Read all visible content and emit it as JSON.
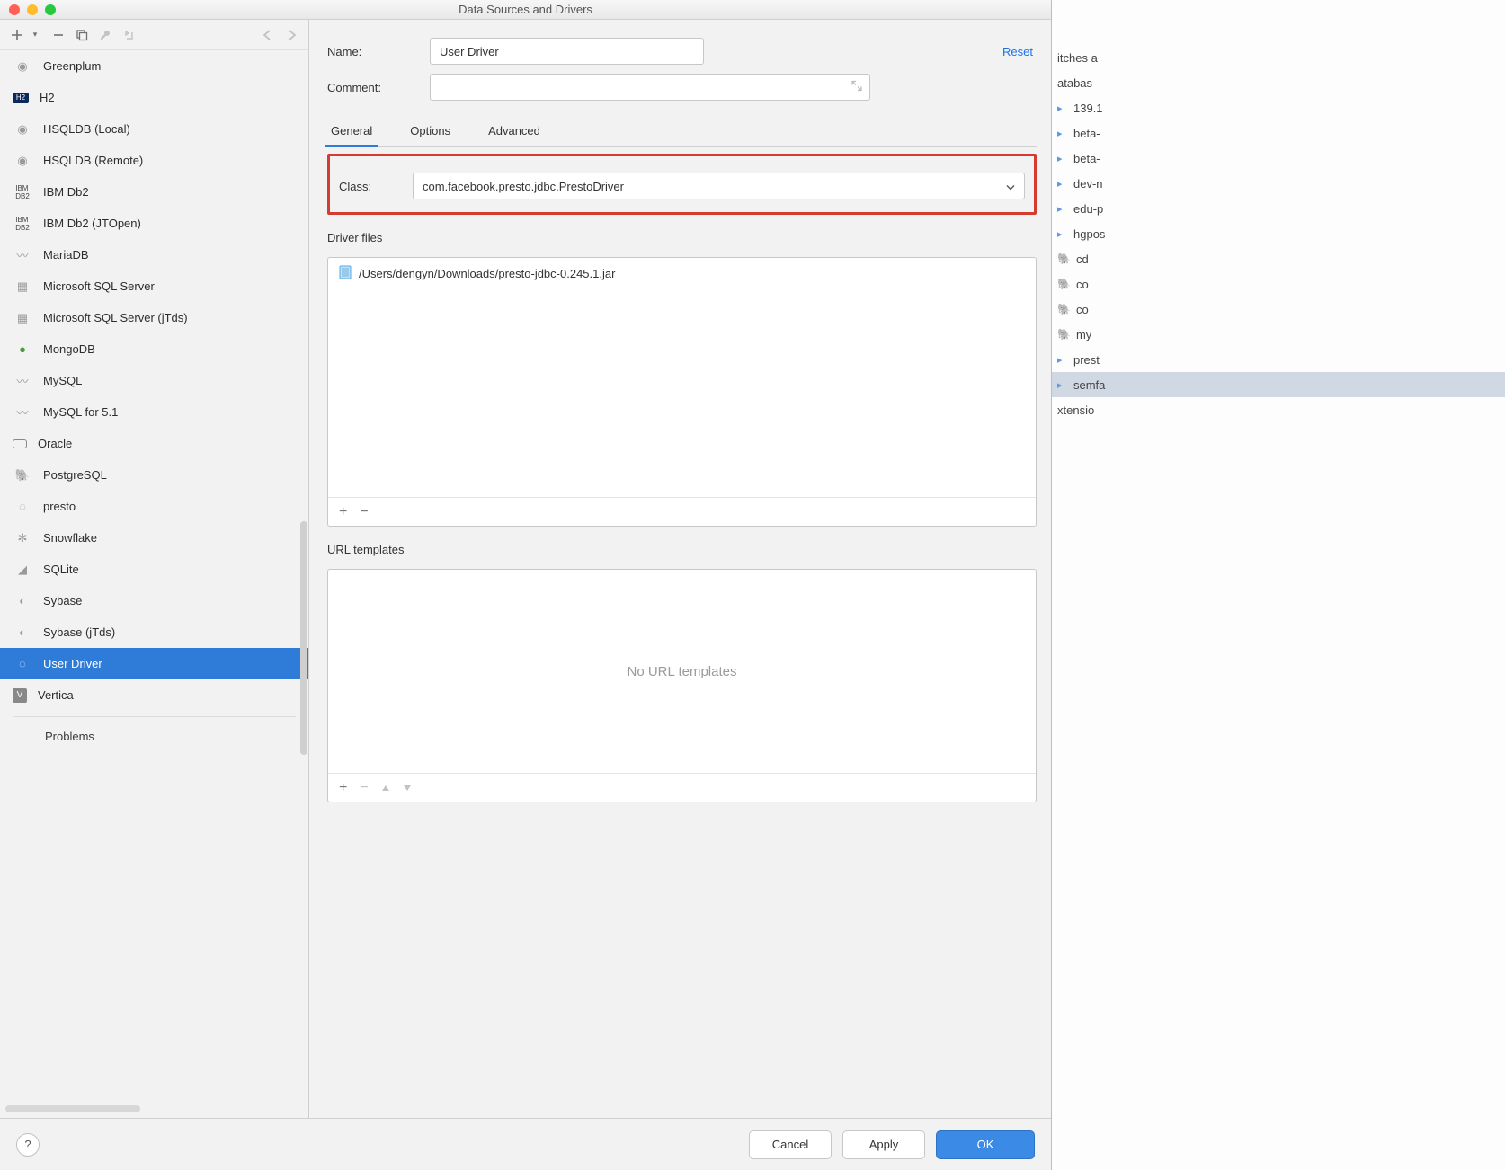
{
  "titlebar": {
    "title": "Data Sources and Drivers"
  },
  "sidebar": {
    "items": [
      {
        "label": "Greenplum"
      },
      {
        "label": "H2"
      },
      {
        "label": "HSQLDB (Local)"
      },
      {
        "label": "HSQLDB (Remote)"
      },
      {
        "label": "IBM Db2"
      },
      {
        "label": "IBM Db2 (JTOpen)"
      },
      {
        "label": "MariaDB"
      },
      {
        "label": "Microsoft SQL Server"
      },
      {
        "label": "Microsoft SQL Server (jTds)"
      },
      {
        "label": "MongoDB"
      },
      {
        "label": "MySQL"
      },
      {
        "label": "MySQL for 5.1"
      },
      {
        "label": "Oracle"
      },
      {
        "label": "PostgreSQL"
      },
      {
        "label": "presto"
      },
      {
        "label": "Snowflake"
      },
      {
        "label": "SQLite"
      },
      {
        "label": "Sybase"
      },
      {
        "label": "Sybase (jTds)"
      },
      {
        "label": "User Driver",
        "selected": true
      },
      {
        "label": "Vertica"
      }
    ],
    "problems_label": "Problems"
  },
  "form": {
    "name_label": "Name:",
    "name_value": "User Driver",
    "comment_label": "Comment:",
    "reset_label": "Reset",
    "tabs": {
      "general": "General",
      "options": "Options",
      "advanced": "Advanced"
    },
    "class_label": "Class:",
    "class_value": "com.facebook.presto.jdbc.PrestoDriver",
    "driver_files_label": "Driver files",
    "driver_file_path": "/Users/dengyn/Downloads/presto-jdbc-0.245.1.jar",
    "url_templates_label": "URL templates",
    "url_templates_empty": "No URL templates"
  },
  "buttons": {
    "cancel": "Cancel",
    "apply": "Apply",
    "ok": "OK",
    "help": "?"
  },
  "background": {
    "rows": [
      "itches a",
      "atabas",
      "139.1",
      "beta-",
      "beta-",
      "dev-n",
      "edu-p",
      "hgpos",
      "cd",
      "co",
      "co",
      "my",
      "prest",
      "semfa",
      "xtensio"
    ]
  }
}
